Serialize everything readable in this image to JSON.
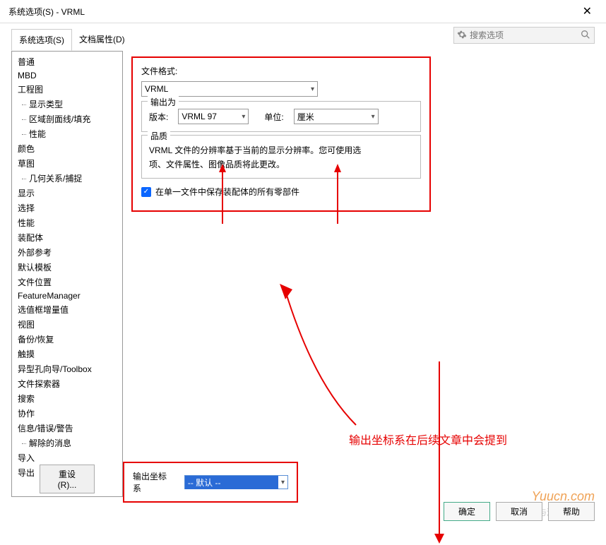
{
  "window": {
    "title": "系统选项(S) - VRML",
    "close": "✕"
  },
  "search": {
    "placeholder": "搜索选项"
  },
  "tabs": {
    "system": "系统选项(S)",
    "doc": "文档属性(D)"
  },
  "tree": {
    "items": [
      {
        "label": "普通",
        "child": false
      },
      {
        "label": "MBD",
        "child": false
      },
      {
        "label": "工程图",
        "child": false
      },
      {
        "label": "显示类型",
        "child": true
      },
      {
        "label": "区域剖面线/填充",
        "child": true
      },
      {
        "label": "性能",
        "child": true
      },
      {
        "label": "颜色",
        "child": false
      },
      {
        "label": "草图",
        "child": false
      },
      {
        "label": "几何关系/捕捉",
        "child": true
      },
      {
        "label": "显示",
        "child": false
      },
      {
        "label": "选择",
        "child": false
      },
      {
        "label": "性能",
        "child": false
      },
      {
        "label": "装配体",
        "child": false
      },
      {
        "label": "外部参考",
        "child": false
      },
      {
        "label": "默认模板",
        "child": false
      },
      {
        "label": "文件位置",
        "child": false
      },
      {
        "label": "FeatureManager",
        "child": false
      },
      {
        "label": "选值框增量值",
        "child": false
      },
      {
        "label": "视图",
        "child": false
      },
      {
        "label": "备份/恢复",
        "child": false
      },
      {
        "label": "触摸",
        "child": false
      },
      {
        "label": "异型孔向导/Toolbox",
        "child": false
      },
      {
        "label": "文件探索器",
        "child": false
      },
      {
        "label": "搜索",
        "child": false
      },
      {
        "label": "协作",
        "child": false
      },
      {
        "label": "信息/错误/警告",
        "child": false
      },
      {
        "label": "解除的消息",
        "child": true
      },
      {
        "label": "导入",
        "child": false
      },
      {
        "label": "导出",
        "child": false
      }
    ],
    "reset": "重设(R)..."
  },
  "form": {
    "file_format_label": "文件格式:",
    "file_format_value": "VRML",
    "output_legend": "输出为",
    "version_label": "版本:",
    "version_value": "VRML 97",
    "unit_label": "单位:",
    "unit_value": "厘米",
    "quality_legend": "品质",
    "quality_text1": "VRML 文件的分辨率基于当前的显示分辨率。您可使用选",
    "quality_text2": "项、文件属性、图像品质将此更改。",
    "checkbox_label": "在单一文件中保存装配体的所有零部件",
    "coord_label": "输出坐标系",
    "coord_value": "-- 默认 --"
  },
  "annotation": {
    "text": "输出坐标系在后续文章中会提到"
  },
  "buttons": {
    "ok": "确定",
    "cancel": "取消",
    "help": "帮助"
  },
  "watermark": {
    "site": "Yuucn.com",
    "author": "@小麦与酒"
  }
}
